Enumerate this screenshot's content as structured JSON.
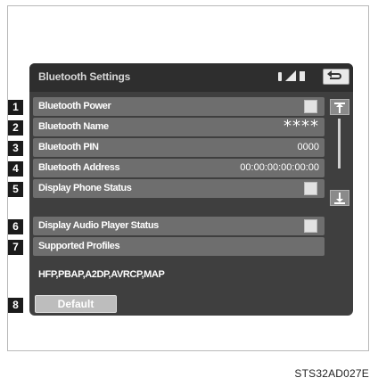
{
  "screen": {
    "title": "Bluetooth Settings"
  },
  "rows": [
    {
      "label": "Bluetooth Power",
      "value": "",
      "has_checkbox": true
    },
    {
      "label": "Bluetooth Name",
      "value": "****",
      "has_checkbox": false
    },
    {
      "label": "Bluetooth PIN",
      "value": "0000",
      "has_checkbox": false
    },
    {
      "label": "Bluetooth Address",
      "value": "00:00:00:00:00:00",
      "has_checkbox": false
    },
    {
      "label": "Display Phone Status",
      "value": "",
      "has_checkbox": true
    },
    {
      "label": "Display Audio Player Status",
      "value": "",
      "has_checkbox": true
    },
    {
      "label": "Supported Profiles",
      "value": "",
      "has_checkbox": false
    }
  ],
  "profiles_value": "HFP,PBAP,A2DP,AVRCP,MAP",
  "default_button": "Default",
  "callouts": [
    "1",
    "2",
    "3",
    "4",
    "5",
    "6",
    "7",
    "8"
  ],
  "figure_code": "STS32AD027E",
  "icons": [
    "bluetooth-icon",
    "signal-strength-icon",
    "battery-icon",
    "back-icon",
    "scroll-up-icon",
    "scroll-down-icon"
  ],
  "colors": {
    "screen_bg": "#3f3f3f",
    "row_bg": "#6e6e6e",
    "callout_bg": "#1b1b1b"
  }
}
